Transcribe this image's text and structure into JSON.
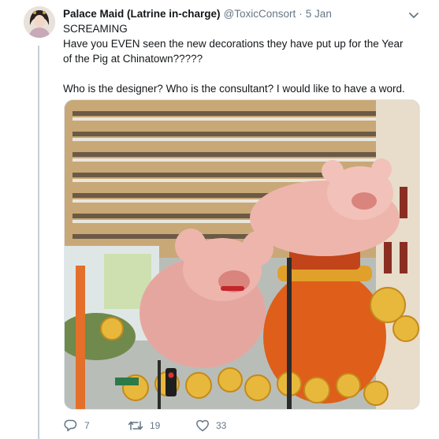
{
  "tweet": {
    "display_name": "Palace Maid (Latrine in-charge)",
    "handle": "@ToxicConsort",
    "separator": "·",
    "timestamp": "5 Jan",
    "text_lines": [
      "SCREAMING",
      "Have you EVEN seen the new decorations they have put up for the Year of the Pig at Chinatown?????",
      "Who is the designer? Who is the consultant? I would like to have a word."
    ],
    "reply_count": "7",
    "retweet_count": "19",
    "like_count": "33"
  },
  "icons": {
    "more": "chevron-down-icon",
    "reply": "reply-icon",
    "retweet": "retweet-icon",
    "like": "heart-icon"
  },
  "colors": {
    "text": "#14171a",
    "secondary": "#657786",
    "thread_line": "#c4cfd6"
  }
}
